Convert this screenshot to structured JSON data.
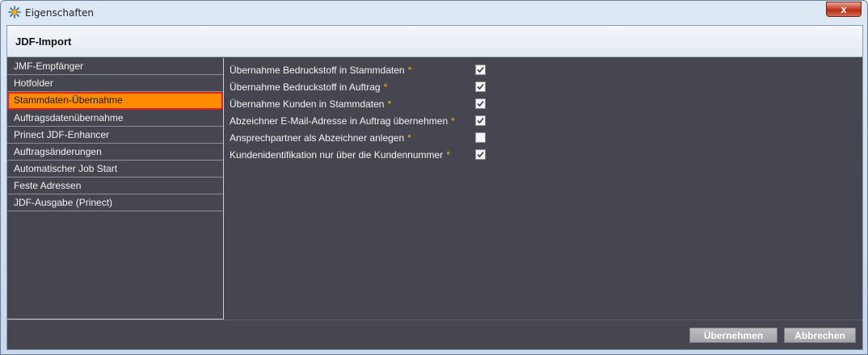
{
  "window": {
    "title": "Eigenschaften",
    "icon": "gear-sun-icon",
    "close_label": "x"
  },
  "header": {
    "title": "JDF-Import"
  },
  "sidebar": {
    "items": [
      {
        "label": "JMF-Empfänger",
        "selected": false
      },
      {
        "label": "Hotfolder",
        "selected": false
      },
      {
        "label": "Stammdaten-Übernahme",
        "selected": true
      },
      {
        "label": "Auftragsdatenübernahme",
        "selected": false
      },
      {
        "label": "Prinect JDF-Enhancer",
        "selected": false
      },
      {
        "label": "Auftragsänderungen",
        "selected": false
      },
      {
        "label": "Automatischer Job Start",
        "selected": false
      },
      {
        "label": "Feste Adressen",
        "selected": false
      },
      {
        "label": "JDF-Ausgabe (Prinect)",
        "selected": false
      }
    ]
  },
  "settings": {
    "required_marker": "*",
    "options": [
      {
        "label": "Übernahme Bedruckstoff in Stammdaten",
        "checked": true
      },
      {
        "label": "Übernahme Bedruckstoff in Auftrag",
        "checked": true
      },
      {
        "label": "Übernahme Kunden in Stammdaten",
        "checked": true
      },
      {
        "label": "Abzeichner E-Mail-Adresse in Auftrag übernehmen",
        "checked": true
      },
      {
        "label": "Ansprechpartner als Abzeichner anlegen",
        "checked": false
      },
      {
        "label": "Kundenidentifikation nur über die Kundennummer",
        "checked": true
      }
    ]
  },
  "footer": {
    "apply_label": "Übernehmen",
    "cancel_label": "Abbrechen"
  },
  "colors": {
    "panel_bg": "#464650",
    "selection": "#ff8c00",
    "selection_border": "#e2231a",
    "required_star": "#ffb400"
  }
}
